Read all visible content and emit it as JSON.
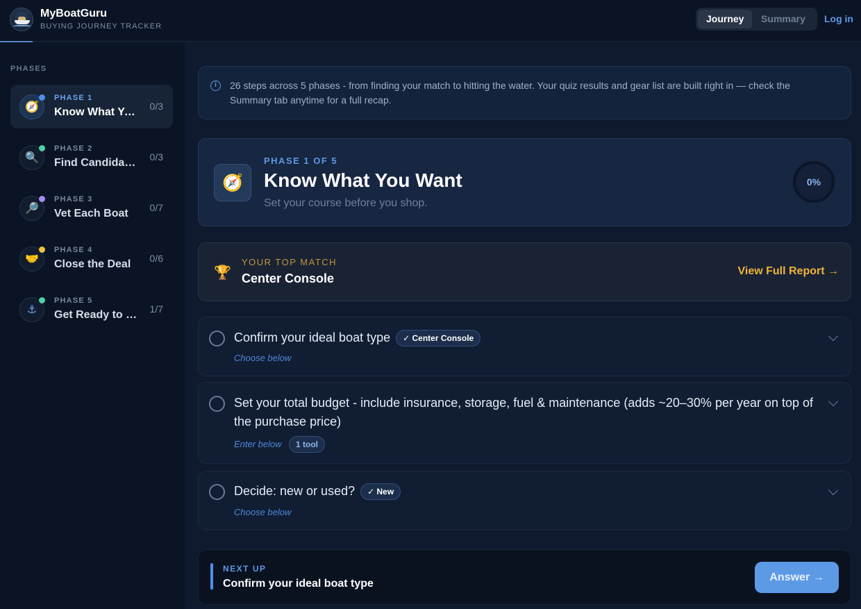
{
  "app": {
    "name": "MyBoatGuru",
    "subtitle": "BUYING JOURNEY TRACKER"
  },
  "nav": {
    "tabs": [
      {
        "label": "Journey",
        "active": true
      },
      {
        "label": "Summary",
        "active": false
      }
    ],
    "login_label": "Log in"
  },
  "sidebar": {
    "label": "PHASES",
    "phases": [
      {
        "number": "PHASE 1",
        "title": "Know What You Want",
        "count": "0/3",
        "icon": "compass-icon",
        "emoji": "🧭",
        "dot_color": "#4f8fe8",
        "active": true
      },
      {
        "number": "PHASE 2",
        "title": "Find Candidates",
        "count": "0/3",
        "icon": "magnifier-icon",
        "emoji": "🔍",
        "dot_color": "#4fd0a6",
        "active": false
      },
      {
        "number": "PHASE 3",
        "title": "Vet Each Boat",
        "count": "0/7",
        "icon": "inspect-icon",
        "emoji": "🔎",
        "dot_color": "#a98af0",
        "active": false
      },
      {
        "number": "PHASE 4",
        "title": "Close the Deal",
        "count": "0/6",
        "icon": "handshake-icon",
        "emoji": "🤝",
        "dot_color": "#f0c040",
        "active": false
      },
      {
        "number": "PHASE 5",
        "title": "Get Ready to Go",
        "count": "1/7",
        "icon": "anchor-icon",
        "emoji": "⚓",
        "dot_color": "#4fd0a6",
        "active": false
      }
    ]
  },
  "info": {
    "text": "26 steps across 5 phases - from finding your match to hitting the water. Your quiz results and gear list are built right in — check the Summary tab anytime for a full recap."
  },
  "current_phase": {
    "label": "PHASE 1 OF 5",
    "title": "Know What You Want",
    "subtitle": "Set your course before you shop.",
    "progress": "0%",
    "icon": "compass-icon"
  },
  "top_match": {
    "label": "YOUR TOP MATCH",
    "value": "Center Console",
    "link": "View Full Report →",
    "icon": "trophy-icon"
  },
  "tasks": [
    {
      "title": "Confirm your ideal boat type",
      "badge": "✓ Center Console",
      "hint": "Choose below"
    },
    {
      "title": "Set your total budget - include insurance, storage, fuel & maintenance (adds ~20–30% per year on top of the purchase price)",
      "hint": "Enter below",
      "tool": "1 tool"
    },
    {
      "title": "Decide: new or used?",
      "badge": "✓ New",
      "hint": "Choose below"
    }
  ],
  "next_up": {
    "label": "NEXT UP",
    "value": "Confirm your ideal boat type",
    "button": "Answer →"
  }
}
